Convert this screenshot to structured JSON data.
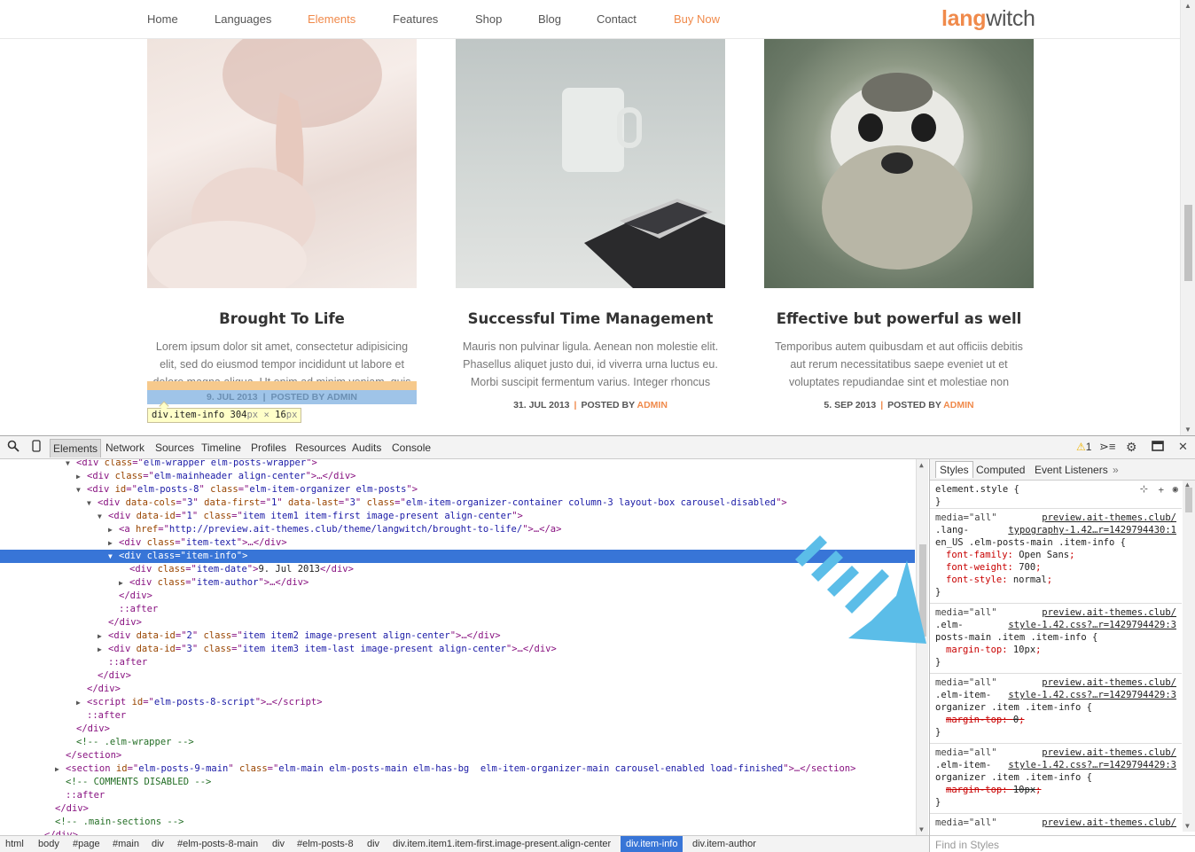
{
  "nav": {
    "items": [
      "Home",
      "Languages",
      "Elements",
      "Features",
      "Shop",
      "Blog",
      "Contact",
      "Buy Now"
    ],
    "active": "Elements",
    "logo_a": "lang",
    "logo_b": "witch"
  },
  "posts": [
    {
      "title": "Brought To Life",
      "excerpt": "Lorem ipsum dolor sit amet, consectetur adipisicing elit, sed do eiusmod tempor incididunt ut labore et dolore magna aliqua. Ut enim ad minim veniam, quis",
      "date": "9. JUL 2013",
      "posted_by": "POSTED BY",
      "author": "ADMIN"
    },
    {
      "title": "Successful Time Management",
      "excerpt": "Mauris non pulvinar ligula. Aenean non molestie elit. Phasellus aliquet justo dui, id viverra urna luctus eu. Morbi suscipit fermentum varius. Integer rhoncus",
      "date": "31. JUL 2013",
      "posted_by": "POSTED BY",
      "author": "ADMIN"
    },
    {
      "title": "Effective but powerful as well",
      "excerpt": "Temporibus autem quibusdam et aut officiis debitis aut rerum necessitatibus saepe eveniet ut et voluptates repudiandae sint et molestiae non",
      "date": "5. SEP 2013",
      "posted_by": "POSTED BY",
      "author": "ADMIN"
    }
  ],
  "tooltip": {
    "selector": "div.item-info",
    "w": "304",
    "x": "×",
    "h": "16",
    "unit": "px"
  },
  "devtools": {
    "tabs": [
      "Elements",
      "Network",
      "Sources",
      "Timeline",
      "Profiles",
      "Resources",
      "Audits",
      "Console"
    ],
    "active_tab": "Elements",
    "warning_count": "1",
    "styles_tabs": [
      "Styles",
      "Computed",
      "Event Listeners"
    ],
    "find_placeholder": "Find in Styles",
    "breadcrumbs": [
      "html",
      "body",
      "#page",
      "#main",
      "div",
      "#elm-posts-8-main",
      "div",
      "#elm-posts-8",
      "div",
      "div.item.item1.item-first.image-present.align-center",
      "div.item-info",
      "div.item-author"
    ],
    "active_crumb": "div.item-info"
  },
  "dom_lines": [
    {
      "indent": 6,
      "arrow": "▼",
      "html": "<span class=\"tag\">&lt;div </span><span class=\"attr\">class</span>=\"<span class=\"val\">elm-wrapper elm-posts-wrapper</span>\"<span class=\"tag\">&gt;</span>"
    },
    {
      "indent": 7,
      "arrow": "▶",
      "html": "<span class=\"tag\">&lt;div </span><span class=\"attr\">class</span>=\"<span class=\"val\">elm-mainheader align-center</span>\"<span class=\"tag\">&gt;…&lt;/div&gt;</span>"
    },
    {
      "indent": 7,
      "arrow": "▼",
      "html": "<span class=\"tag\">&lt;div </span><span class=\"attr\">id</span>=\"<span class=\"val\">elm-posts-8</span>\" <span class=\"attr\">class</span>=\"<span class=\"val\">elm-item-organizer elm-posts</span>\"<span class=\"tag\">&gt;</span>"
    },
    {
      "indent": 8,
      "arrow": "▼",
      "html": "<span class=\"tag\">&lt;div </span><span class=\"attr\">data-cols</span>=\"<span class=\"val\">3</span>\" <span class=\"attr\">data-first</span>=\"<span class=\"val\">1</span>\" <span class=\"attr\">data-last</span>=\"<span class=\"val\">3</span>\" <span class=\"attr\">class</span>=\"<span class=\"val\">elm-item-organizer-container column-3 layout-box carousel-disabled</span>\"<span class=\"tag\">&gt;</span>"
    },
    {
      "indent": 9,
      "arrow": "▼",
      "html": "<span class=\"tag\">&lt;div </span><span class=\"attr\">data-id</span>=\"<span class=\"val\">1</span>\" <span class=\"attr\">class</span>=\"<span class=\"val\">item item1 item-first image-present align-center</span>\"<span class=\"tag\">&gt;</span>"
    },
    {
      "indent": 10,
      "arrow": "▶",
      "html": "<span class=\"tag\">&lt;a </span><span class=\"attr\">href</span>=\"<span class=\"val\">http://preview.ait-themes.club/theme/langwitch/brought-to-life/</span>\"<span class=\"tag\">&gt;…&lt;/a&gt;</span>"
    },
    {
      "indent": 10,
      "arrow": "▶",
      "html": "<span class=\"tag\">&lt;div </span><span class=\"attr\">class</span>=\"<span class=\"val\">item-text</span>\"<span class=\"tag\">&gt;…&lt;/div&gt;</span>"
    },
    {
      "indent": 10,
      "arrow": "▼",
      "sel": true,
      "html": "<span class=\"tag\">&lt;div </span><span class=\"attr\">class</span>=\"<span class=\"val\">item-info</span>\"<span class=\"tag\">&gt;</span>"
    },
    {
      "indent": 11,
      "arrow": "",
      "html": "<span class=\"tag\">&lt;div </span><span class=\"attr\">class</span>=\"<span class=\"val\">item-date</span>\"<span class=\"tag\">&gt;</span><span class=\"txt\">9. Jul 2013</span><span class=\"tag\">&lt;/div&gt;</span>"
    },
    {
      "indent": 11,
      "arrow": "▶",
      "html": "<span class=\"tag\">&lt;div </span><span class=\"attr\">class</span>=\"<span class=\"val\">item-author</span>\"<span class=\"tag\">&gt;…&lt;/div&gt;</span>"
    },
    {
      "indent": 10,
      "arrow": "",
      "html": "<span class=\"tag\">&lt;/div&gt;</span>"
    },
    {
      "indent": 10,
      "arrow": "",
      "html": "<span class=\"pseudo\">::after</span>"
    },
    {
      "indent": 9,
      "arrow": "",
      "html": "<span class=\"tag\">&lt;/div&gt;</span>"
    },
    {
      "indent": 9,
      "arrow": "▶",
      "html": "<span class=\"tag\">&lt;div </span><span class=\"attr\">data-id</span>=\"<span class=\"val\">2</span>\" <span class=\"attr\">class</span>=\"<span class=\"val\">item item2 image-present align-center</span>\"<span class=\"tag\">&gt;…&lt;/div&gt;</span>"
    },
    {
      "indent": 9,
      "arrow": "▶",
      "html": "<span class=\"tag\">&lt;div </span><span class=\"attr\">data-id</span>=\"<span class=\"val\">3</span>\" <span class=\"attr\">class</span>=\"<span class=\"val\">item item3 item-last image-present align-center</span>\"<span class=\"tag\">&gt;…&lt;/div&gt;</span>"
    },
    {
      "indent": 9,
      "arrow": "",
      "html": "<span class=\"pseudo\">::after</span>"
    },
    {
      "indent": 8,
      "arrow": "",
      "html": "<span class=\"tag\">&lt;/div&gt;</span>"
    },
    {
      "indent": 7,
      "arrow": "",
      "html": "<span class=\"tag\">&lt;/div&gt;</span>"
    },
    {
      "indent": 7,
      "arrow": "▶",
      "html": "<span class=\"tag\">&lt;script </span><span class=\"attr\">id</span>=\"<span class=\"val\">elm-posts-8-script</span>\"<span class=\"tag\">&gt;…&lt;/script&gt;</span>"
    },
    {
      "indent": 7,
      "arrow": "",
      "html": "<span class=\"pseudo\">::after</span>"
    },
    {
      "indent": 6,
      "arrow": "",
      "html": "<span class=\"tag\">&lt;/div&gt;</span>"
    },
    {
      "indent": 6,
      "arrow": "",
      "html": "<span class=\"cmt\">&lt;!-- .elm-wrapper --&gt;</span>"
    },
    {
      "indent": 5,
      "arrow": "",
      "html": "<span class=\"tag\">&lt;/section&gt;</span>"
    },
    {
      "indent": 5,
      "arrow": "▶",
      "html": "<span class=\"tag\">&lt;section </span><span class=\"attr\">id</span>=\"<span class=\"val\">elm-posts-9-main</span>\" <span class=\"attr\">class</span>=\"<span class=\"val\">elm-main elm-posts-main elm-has-bg  elm-item-organizer-main carousel-enabled load-finished</span>\"<span class=\"tag\">&gt;…&lt;/section&gt;</span>"
    },
    {
      "indent": 5,
      "arrow": "",
      "html": "<span class=\"cmt\">&lt;!-- COMMENTS DISABLED --&gt;</span>"
    },
    {
      "indent": 5,
      "arrow": "",
      "html": "<span class=\"pseudo\">::after</span>"
    },
    {
      "indent": 4,
      "arrow": "",
      "html": "<span class=\"tag\">&lt;/div&gt;</span>"
    },
    {
      "indent": 4,
      "arrow": "",
      "html": "<span class=\"cmt\">&lt;!-- .main-sections --&gt;</span>"
    },
    {
      "indent": 3,
      "arrow": "",
      "html": "<span class=\"tag\">&lt;/div&gt;</span>"
    }
  ],
  "style_rules": [
    {
      "lines": [
        "element.style {",
        "}"
      ]
    },
    {
      "media": "media=\"all\"",
      "src": "preview.ait-themes.club/",
      "src2": "typography-1.42…r=1429794430:1",
      "sel": [
        ".lang-",
        "en_US .elm-posts-main .item-info {"
      ],
      "props": [
        [
          "font-family",
          "Open Sans"
        ],
        [
          "font-weight",
          "700"
        ],
        [
          "font-style",
          "normal"
        ]
      ],
      "strike": false
    },
    {
      "media": "media=\"all\"",
      "src": "preview.ait-themes.club/",
      "src2": "style-1.42.css?…r=1429794429:3",
      "sel": [
        ".elm-",
        "posts-main .item .item-info {"
      ],
      "props": [
        [
          "margin-top",
          "10px"
        ]
      ],
      "strike": false
    },
    {
      "media": "media=\"all\"",
      "src": "preview.ait-themes.club/",
      "src2": "style-1.42.css?…r=1429794429:3",
      "sel": [
        ".elm-item-",
        "organizer .item .item-info {"
      ],
      "props": [
        [
          "margin-top",
          "0"
        ]
      ],
      "strike": true
    },
    {
      "media": "media=\"all\"",
      "src": "preview.ait-themes.club/",
      "src2": "style-1.42.css?…r=1429794429:3",
      "sel": [
        ".elm-item-",
        "organizer .item .item-info {"
      ],
      "props": [
        [
          "margin-top",
          "10px"
        ]
      ],
      "strike": true
    },
    {
      "media": "media=\"all\"",
      "src": "preview.ait-themes.club/",
      "src2": "",
      "sel": [],
      "props": [],
      "strike": false
    }
  ],
  "colors": {
    "accent": "#f08a4b",
    "selection": "#3875d7",
    "arrow": "#5bbde8"
  }
}
